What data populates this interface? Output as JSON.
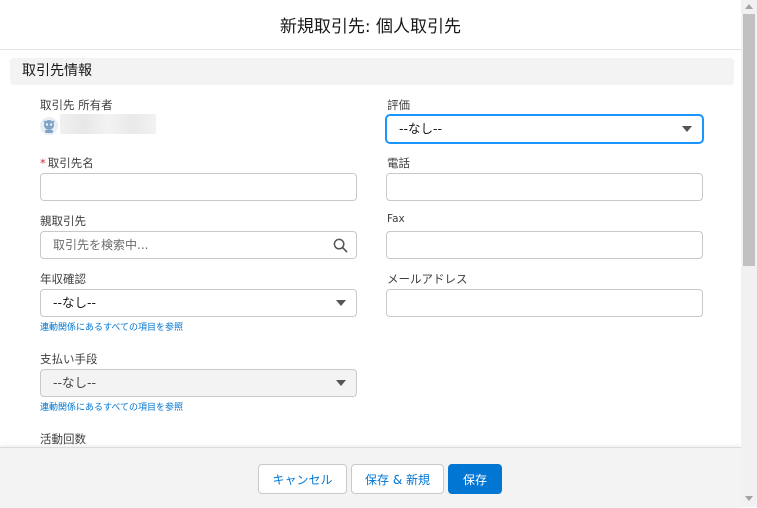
{
  "modal": {
    "title": "新規取引先: 個人取引先"
  },
  "section": {
    "title": "取引先情報"
  },
  "fields": {
    "owner": {
      "label": "取引先 所有者"
    },
    "rating": {
      "label": "評価",
      "value": "--なし--"
    },
    "account_name": {
      "required_mark": "*",
      "label": "取引先名",
      "value": ""
    },
    "phone": {
      "label": "電話",
      "value": ""
    },
    "parent_account": {
      "label": "親取引先",
      "placeholder": "取引先を検索中..."
    },
    "fax": {
      "label": "Fax",
      "value": ""
    },
    "annual_check": {
      "label": "年収確認",
      "value": "--なし--",
      "link": "連動関係にあるすべての項目を参照"
    },
    "email": {
      "label": "メールアドレス",
      "value": ""
    },
    "payment_method": {
      "label": "支払い手段",
      "value": "--なし--",
      "link": "連動関係にあるすべての項目を参照"
    },
    "activity_count": {
      "label": "活動回数"
    }
  },
  "footer": {
    "cancel_label": "キャンセル",
    "save_new_label": "保存 & 新規",
    "save_label": "保存"
  },
  "colors": {
    "brand": "#0176d3",
    "focus": "#1b96ff",
    "required": "#c23934"
  }
}
